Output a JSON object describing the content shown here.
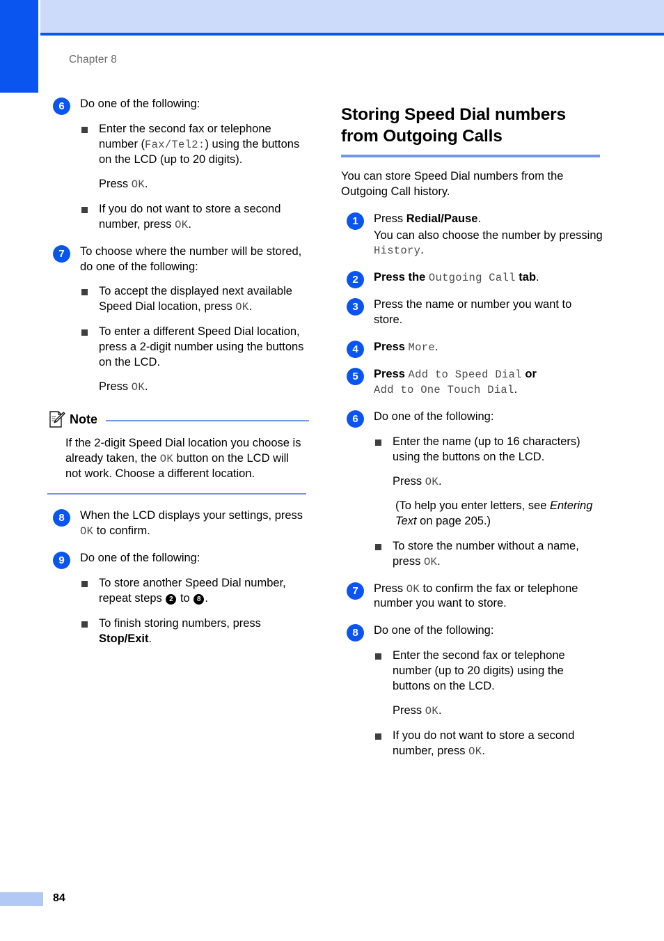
{
  "page": {
    "chapter_label": "Chapter 8",
    "page_number": "84"
  },
  "left_column": {
    "steps": [
      {
        "marker": "6",
        "lead": "Do one of the following:",
        "bullets": [
          {
            "text_before": "Enter the second fax or telephone number (",
            "mono": "Fax/Tel2:",
            "text_after": ") using the buttons on the LCD (up to 20 digits).",
            "follow_press": "Press ",
            "follow_mono": "OK",
            "follow_end": "."
          },
          {
            "text_before": "If you do not want to store a second number, press ",
            "mono": "OK",
            "text_after": "."
          }
        ]
      },
      {
        "marker": "7",
        "lead": "To choose where the number will be stored, do one of the following:",
        "bullets": [
          {
            "text_before": "To accept the displayed next available Speed Dial location, press ",
            "mono": "OK",
            "text_after": "."
          },
          {
            "text_before": "To enter a different Speed Dial location, press a 2-digit number using the buttons on the LCD.",
            "follow_press": "Press ",
            "follow_mono": "OK",
            "follow_end": "."
          }
        ]
      }
    ],
    "note": {
      "title": "Note",
      "body_before": "If the 2-digit Speed Dial location you choose is already taken, the ",
      "body_mono": "OK",
      "body_after": " button on the LCD will not work. Choose a different location."
    },
    "steps_after_note": [
      {
        "marker": "8",
        "text_before": "When the LCD displays your settings, press ",
        "mono": "OK",
        "text_after": " to confirm."
      },
      {
        "marker": "9",
        "lead": "Do one of the following:",
        "bullets": [
          {
            "text_before": "To store another Speed Dial number, repeat steps ",
            "ref_a": "2",
            "text_mid": " to ",
            "ref_b": "8",
            "text_after": "."
          },
          {
            "text_before": "To finish storing numbers, press ",
            "bold": "Stop/Exit",
            "text_after": "."
          }
        ]
      }
    ]
  },
  "right_column": {
    "heading": "Storing Speed Dial numbers from Outgoing Calls",
    "intro": "You can store Speed Dial numbers from the Outgoing Call history.",
    "steps": [
      {
        "marker": "1",
        "line1_before": "Press ",
        "line1_bold": "Redial/Pause",
        "line1_after": ".",
        "line2_before": "You can also choose the number by pressing ",
        "line2_mono": "History",
        "line2_after": "."
      },
      {
        "marker": "2",
        "text_before": "Press the ",
        "mono": "Outgoing Call",
        "bold_after": " tab",
        "text_after": "."
      },
      {
        "marker": "3",
        "text": "Press the name or number you want to store."
      },
      {
        "marker": "4",
        "text_before": "Press ",
        "mono": "More",
        "text_after": "."
      },
      {
        "marker": "5",
        "text_before": "Press ",
        "mono": "Add to Speed Dial",
        "bold_mid": " or",
        "mono2": "Add to One Touch Dial",
        "text_after": "."
      },
      {
        "marker": "6",
        "lead": "Do one of the following:",
        "bullets": [
          {
            "text": "Enter the name (up to 16 characters) using the buttons on the LCD.",
            "follow_press": "Press ",
            "follow_mono": "OK",
            "follow_end": ".",
            "note_before": " (To help you enter letters, see ",
            "note_italic": "Entering Text",
            "note_after": " on page 205.)"
          },
          {
            "text_before": "To store the number without a name, press ",
            "mono": "OK",
            "text_after": "."
          }
        ]
      },
      {
        "marker": "7",
        "text_before": "Press ",
        "mono": "OK",
        "text_after": " to confirm the fax or telephone number you want to store."
      },
      {
        "marker": "8",
        "lead": "Do one of the following:",
        "bullets": [
          {
            "text": "Enter the second fax or telephone number (up to 20 digits) using the buttons on the LCD.",
            "follow_press": "Press ",
            "follow_mono": "OK",
            "follow_end": "."
          },
          {
            "text_before": "If you do not want to store a second number, press ",
            "mono": "OK",
            "text_after": "."
          }
        ]
      }
    ]
  },
  "colors": {
    "accent_blue": "#0a55f0",
    "band_blue": "#ccdbfa",
    "rule_blue": "#6f96e8",
    "footer_tab_blue": "#b3c9f5",
    "mono_gray": "#4a4a4a",
    "chapter_gray": "#6b6b6b"
  }
}
